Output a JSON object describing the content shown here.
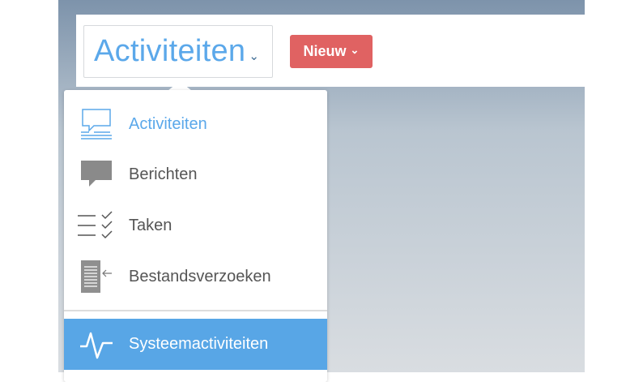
{
  "header": {
    "dropdown_label": "Activiteiten",
    "new_button": "Nieuw"
  },
  "menu": {
    "items": [
      {
        "label": "Activiteiten",
        "icon": "activity-feed-icon"
      },
      {
        "label": "Berichten",
        "icon": "message-icon"
      },
      {
        "label": "Taken",
        "icon": "tasks-icon"
      },
      {
        "label": "Bestandsverzoeken",
        "icon": "file-request-icon"
      },
      {
        "label": "Systeemactiviteiten",
        "icon": "pulse-icon"
      }
    ]
  },
  "colors": {
    "accent": "#58a6e6",
    "new": "#e06262"
  }
}
